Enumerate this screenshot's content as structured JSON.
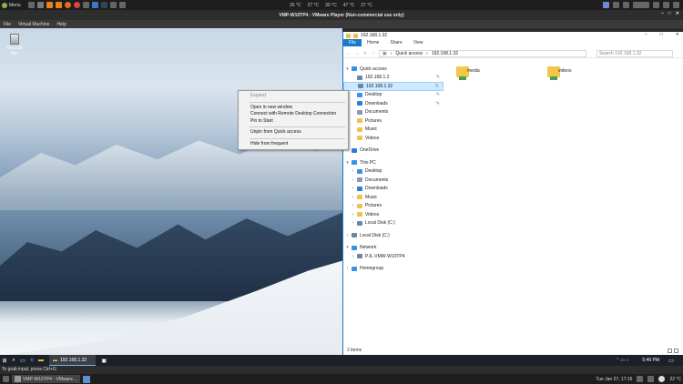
{
  "host_panel": {
    "menu_label": "Menu",
    "temps": [
      "26 °C",
      "27 °C",
      "30 °C",
      "47 °C",
      "27 °C"
    ]
  },
  "vmware": {
    "title": "VMP-W10TP4 - VMware Player (Non-commercial use only)",
    "menu": [
      "File",
      "Virtual Machine",
      "Help"
    ],
    "status": "To grab input, press Ctrl+G"
  },
  "desktop": {
    "recycle_bin_label": "Recycle Bin"
  },
  "context_menu": {
    "items": [
      {
        "label": "Expand",
        "disabled": true
      },
      {
        "sep": true
      },
      {
        "label": "Open in new window"
      },
      {
        "label": "Connect with Remote Desktop Connection"
      },
      {
        "label": "Pin to Start"
      },
      {
        "sep": true
      },
      {
        "label": "Unpin from Quick access"
      },
      {
        "sep": true
      },
      {
        "label": "Hide from frequent"
      }
    ]
  },
  "explorer": {
    "title": "192.168.1.32",
    "ribbon_tabs": [
      "File",
      "Home",
      "Share",
      "View"
    ],
    "breadcrumb": [
      "Quick access",
      "192.168.1.32"
    ],
    "search_placeholder": "Search 192.168.1.32",
    "nav": [
      {
        "label": "Quick access",
        "level": 0,
        "icon": "star-icon",
        "color": "#3a8ee6",
        "arrow": "▾"
      },
      {
        "label": "192.168.1.2",
        "level": 1,
        "icon": "network-computer-icon",
        "color": "#6a86a6",
        "pin": true
      },
      {
        "label": "192.168.1.32",
        "level": 1,
        "icon": "network-computer-icon",
        "color": "#6a86a6",
        "pin": true,
        "selected": true
      },
      {
        "label": "Desktop",
        "level": 1,
        "icon": "desktop-folder-icon",
        "color": "#3a8ee6",
        "pin": true
      },
      {
        "label": "Downloads",
        "level": 1,
        "icon": "downloads-folder-icon",
        "color": "#2c7cd6",
        "pin": true
      },
      {
        "label": "Documents",
        "level": 1,
        "icon": "documents-folder-icon",
        "color": "#8a99ad"
      },
      {
        "label": "Pictures",
        "level": 1,
        "icon": "pictures-folder-icon",
        "color": "#f0c14b"
      },
      {
        "label": "Music",
        "level": 1,
        "icon": "music-folder-icon",
        "color": "#f0c14b"
      },
      {
        "label": "Videos",
        "level": 1,
        "icon": "videos-folder-icon",
        "color": "#f0c14b"
      },
      {
        "gap": true
      },
      {
        "label": "OneDrive",
        "level": 0,
        "icon": "onedrive-icon",
        "color": "#2c7cd6",
        "arrow": "›"
      },
      {
        "gap": true
      },
      {
        "label": "This PC",
        "level": 0,
        "icon": "computer-icon",
        "color": "#3a8ee6",
        "arrow": "▾"
      },
      {
        "label": "Desktop",
        "level": 1,
        "icon": "desktop-folder-icon",
        "color": "#3a8ee6",
        "arrow": "›"
      },
      {
        "label": "Documents",
        "level": 1,
        "icon": "documents-folder-icon",
        "color": "#8a99ad",
        "arrow": "›"
      },
      {
        "label": "Downloads",
        "level": 1,
        "icon": "downloads-folder-icon",
        "color": "#2c7cd6",
        "arrow": "›"
      },
      {
        "label": "Music",
        "level": 1,
        "icon": "music-folder-icon",
        "color": "#f0c14b",
        "arrow": "›"
      },
      {
        "label": "Pictures",
        "level": 1,
        "icon": "pictures-folder-icon",
        "color": "#f0c14b",
        "arrow": "›"
      },
      {
        "label": "Videos",
        "level": 1,
        "icon": "videos-folder-icon",
        "color": "#f0c14b",
        "arrow": "›"
      },
      {
        "label": "Local Disk (C:)",
        "level": 1,
        "icon": "drive-icon",
        "color": "#6a86a6",
        "arrow": "›"
      },
      {
        "gap": true
      },
      {
        "label": "Local Disk (C:)",
        "level": 0,
        "icon": "drive-icon",
        "color": "#6a86a6",
        "arrow": "›"
      },
      {
        "gap": true
      },
      {
        "label": "Network",
        "level": 0,
        "icon": "network-icon",
        "color": "#3a8ee6",
        "arrow": "▾"
      },
      {
        "label": "PJL-VMW-W10TP4",
        "level": 1,
        "icon": "network-computer-icon",
        "color": "#6a86a6",
        "arrow": "›"
      },
      {
        "gap": true
      },
      {
        "label": "Homegroup",
        "level": 0,
        "icon": "homegroup-icon",
        "color": "#3a8ee6",
        "arrow": "›"
      }
    ],
    "folders": [
      "media",
      "videos"
    ],
    "status": "2 items"
  },
  "guest_taskbar": {
    "app_label": "192.168.1.32",
    "clock": "5:46 PM"
  },
  "host_taskbar": {
    "app_label": "VMP-W10TP4 - VMware…",
    "datetime": "Tue Jan 27, 17:16",
    "temp": "22 °C"
  }
}
